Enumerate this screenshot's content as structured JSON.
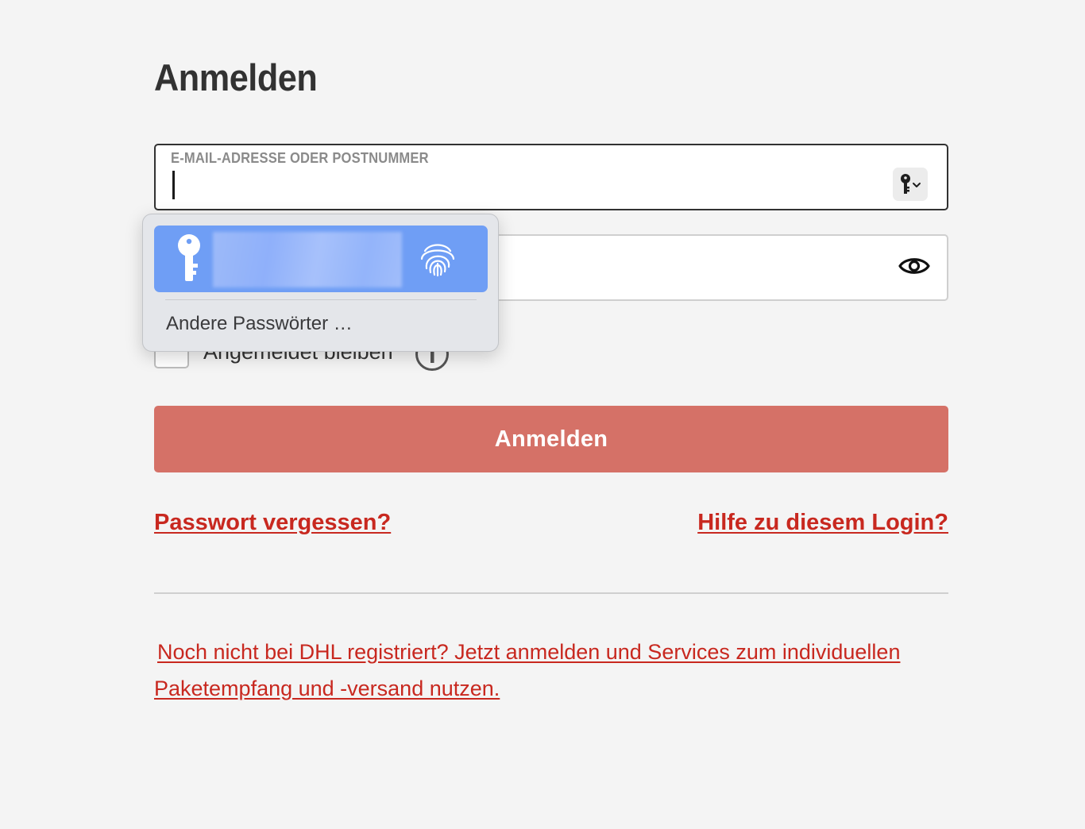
{
  "page": {
    "title": "Anmelden"
  },
  "login_form": {
    "email_label": "E-MAIL-ADRESSE ODER POSTNUMMER",
    "email_value": "",
    "keychain_icon": "key-dropdown-icon",
    "password_value": "",
    "password_toggle_icon": "eye-icon",
    "remember_label": "Angemeldet bleiben",
    "remember_checked": false,
    "info_icon": "info-icon",
    "submit_label": "Anmelden",
    "submit_color": "#d57167"
  },
  "links": {
    "forgot_password": "Passwort vergessen?",
    "help": "Hilfe zu diesem Login?",
    "register": "Noch nicht bei DHL registriert? Jetzt anmelden und Services zum individuellen Paketempfang und -versand nutzen.",
    "link_color": "#c8281f"
  },
  "autofill_popup": {
    "credential_icon": "key-icon",
    "credential_action_icon": "fingerprint-icon",
    "credential_highlight_color": "#6f9ef5",
    "other_passwords_label": "Andere Passwörter …"
  }
}
